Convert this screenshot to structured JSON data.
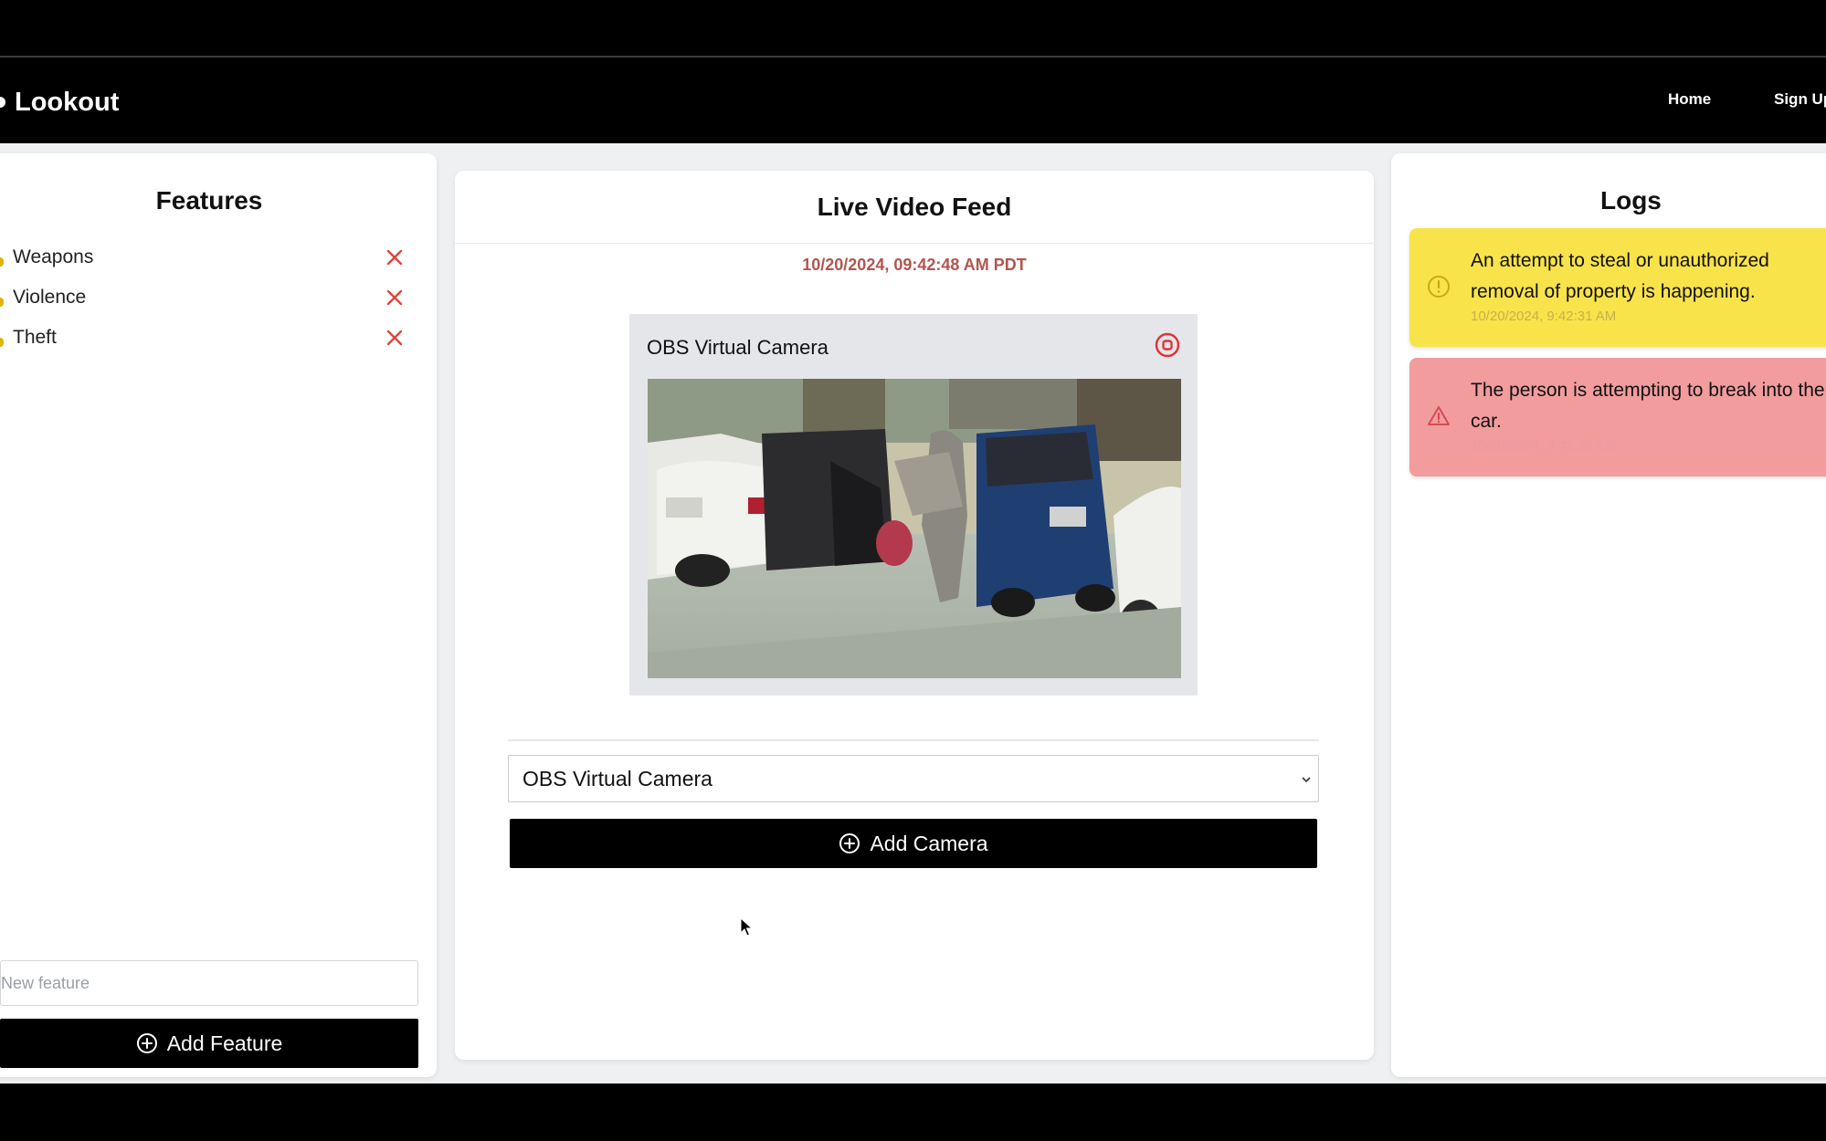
{
  "navbar": {
    "brand": "Lookout",
    "links": [
      {
        "label": "Home"
      },
      {
        "label": "Sign Up"
      }
    ]
  },
  "features": {
    "title": "Features",
    "items": [
      {
        "label": "Weapons"
      },
      {
        "label": "Violence"
      },
      {
        "label": "Theft"
      }
    ],
    "input_placeholder": "New feature",
    "add_label": "Add Feature"
  },
  "video": {
    "title": "Live Video Feed",
    "timestamp": "10/20/2024, 09:42:48 AM PDT",
    "camera_name": "OBS Virtual Camera",
    "select_value": "OBS Virtual Camera",
    "add_camera_label": "Add Camera"
  },
  "logs": {
    "title": "Logs",
    "entries": [
      {
        "message": "An attempt to steal or unauthorized removal of property is happening.",
        "time": "10/20/2024, 9:42:31 AM",
        "level": "warning",
        "color": "#f8e34b"
      },
      {
        "message": "The person is attempting to break into the car.",
        "time": "10/20/2024, 9:42:36 AM",
        "level": "alert",
        "color": "#f29c9e"
      }
    ]
  },
  "colors": {
    "remove_icon": "#d9473f",
    "timestamp": "#b2564e",
    "stop_icon": "#e0323a"
  }
}
